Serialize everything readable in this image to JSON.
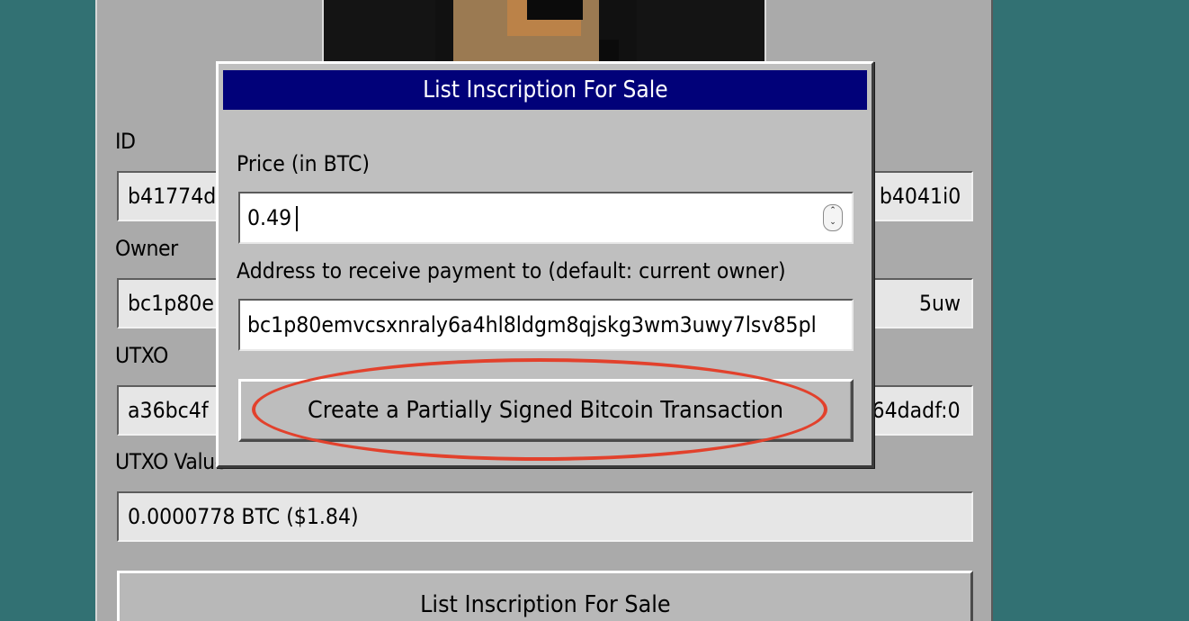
{
  "panel": {
    "fields": [
      {
        "label": "ID",
        "value_start": "b41774d",
        "value_end": "b4041i0"
      },
      {
        "label": "Owner",
        "value_start": "bc1p80e",
        "value_end": "5uw"
      },
      {
        "label": "UTXO",
        "value_start": "a36bc4f",
        "value_end": "64dadf:0"
      },
      {
        "label": "UTXO Value",
        "value_start": "0.0000778 BTC ($1.84)",
        "value_end": ""
      }
    ],
    "list_button_label": "List Inscription For Sale"
  },
  "dialog": {
    "title": "List Inscription For Sale",
    "price_label": "Price (in BTC)",
    "price_value": "0.49",
    "stepper_up": "⌃",
    "stepper_down": "⌄",
    "address_label": "Address to receive payment to (default: current owner)",
    "address_value": "bc1p80emvcsxnraly6a4hl8ldgm8qjskg3wm3uwy7lsv85pl",
    "submit_label": "Create a Partially Signed Bitcoin Transaction"
  },
  "colors": {
    "desktop": "#327173",
    "titlebar": "#010179",
    "highlight": "#e2412c"
  }
}
